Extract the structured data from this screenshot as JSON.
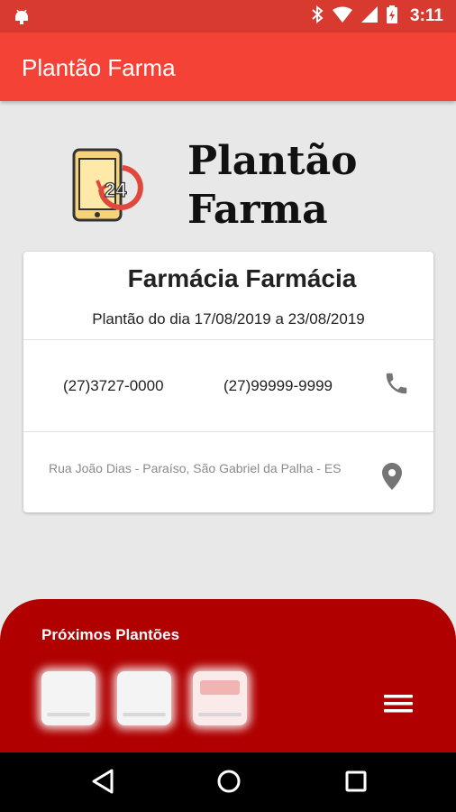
{
  "status_bar": {
    "time": "3:11",
    "icons": [
      "android-icon",
      "bluetooth-icon",
      "wifi-icon",
      "signal-icon",
      "battery-charging-icon"
    ]
  },
  "app_bar": {
    "title": "Plantão Farma"
  },
  "brand": {
    "logo_icon": "phone-24h-icon",
    "title_line1": "Plantão",
    "title_line2": "Farma"
  },
  "pharmacy": {
    "name": "Farmácia Farmácia",
    "period": "Plantão do dia 17/08/2019 a 23/08/2019",
    "phone1": "(27)3727-0000",
    "phone2": "(27)99999-9999",
    "address": "Rua João Dias - Paraíso, São Gabriel da Palha - ES"
  },
  "next_shifts": {
    "title": "Próximos Plantões",
    "thumbnails": [
      "pharmacy-thumbnail-1",
      "pharmacy-thumbnail-2",
      "pharmacy-thumbnail-3"
    ]
  },
  "colors": {
    "status_bar": "#d93a30",
    "app_bar": "#f44336",
    "bottom_panel": "#b00000",
    "background": "#e8e8e8"
  }
}
